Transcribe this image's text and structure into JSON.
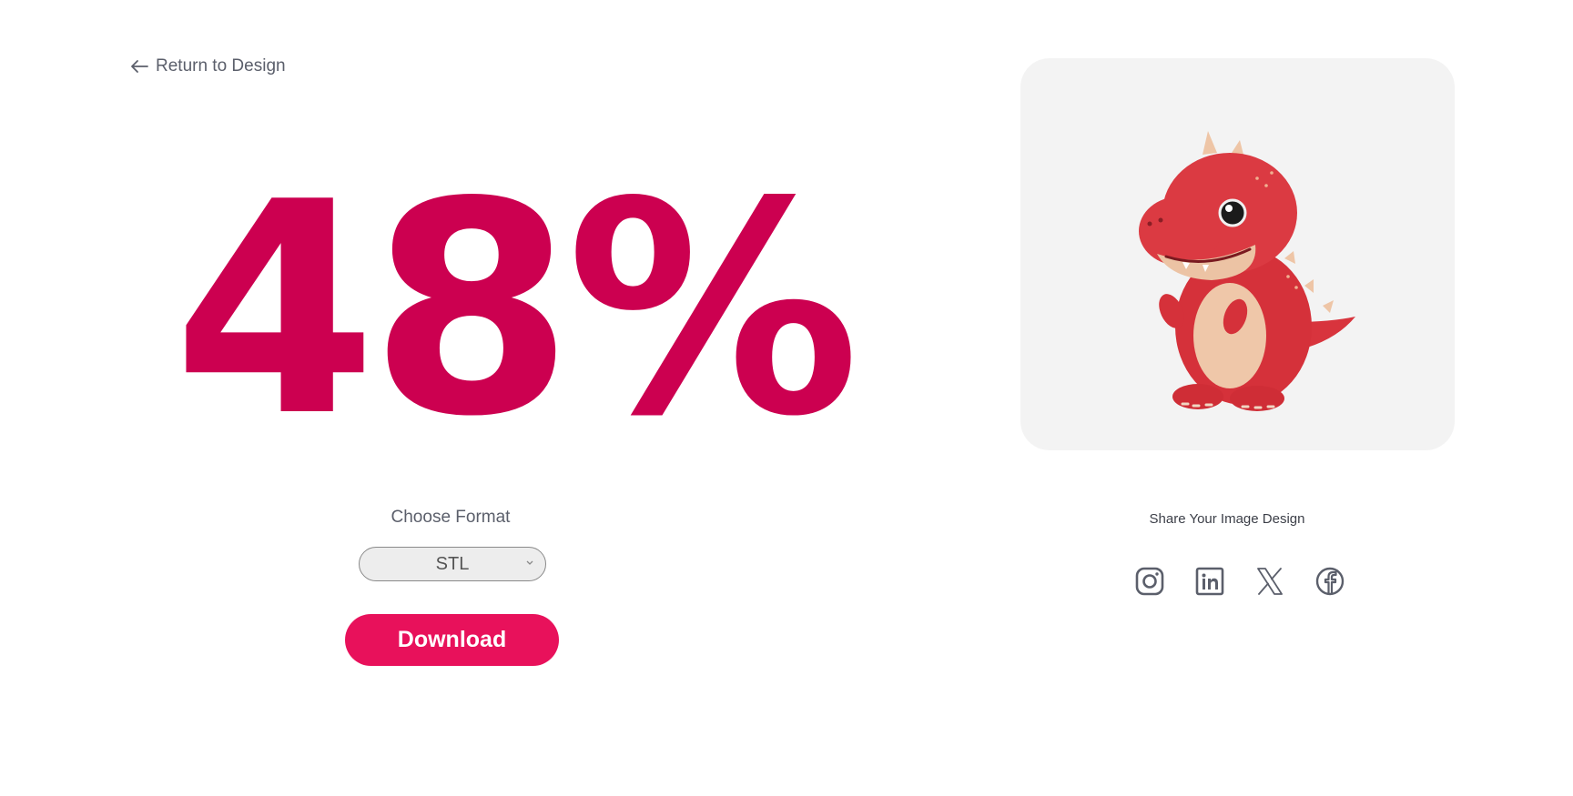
{
  "nav": {
    "return_label": "Return to Design"
  },
  "progress": {
    "text": "48%",
    "value": 48
  },
  "format": {
    "label": "Choose Format",
    "selected": "STL"
  },
  "download": {
    "label": "Download"
  },
  "share": {
    "label": "Share Your Image Design",
    "icons": [
      "instagram-icon",
      "linkedin-icon",
      "x-icon",
      "facebook-icon"
    ]
  },
  "colors": {
    "accent": "#cc0050",
    "button": "#e8115b",
    "muted_text": "#5b5f6b",
    "card_bg": "#f3f3f3"
  }
}
